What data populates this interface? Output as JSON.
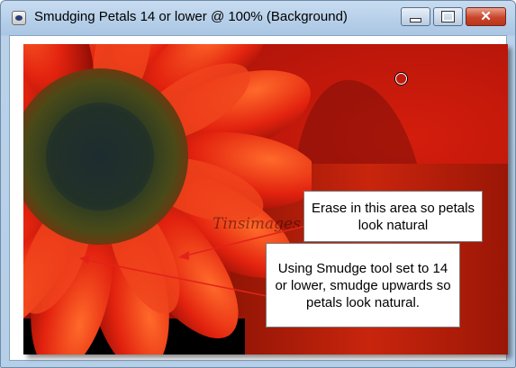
{
  "window": {
    "title": "Smudging Petals 14 or lower @ 100% (Background)",
    "app_icon": "paintshop-icon",
    "controls": {
      "minimize": "minimize-icon",
      "maximize": "maximize-icon",
      "close": "close-icon"
    }
  },
  "canvas": {
    "watermark": "Tinsimages",
    "callouts": [
      {
        "text": "Erase in this area so petals look natural"
      },
      {
        "text": "Using Smudge tool set to 14 or lower, smudge upwards so petals look natural."
      }
    ],
    "colors": {
      "background_red": "#b0140a",
      "callout_border": "#7a7a7a",
      "arrow": "#e3231a"
    }
  }
}
